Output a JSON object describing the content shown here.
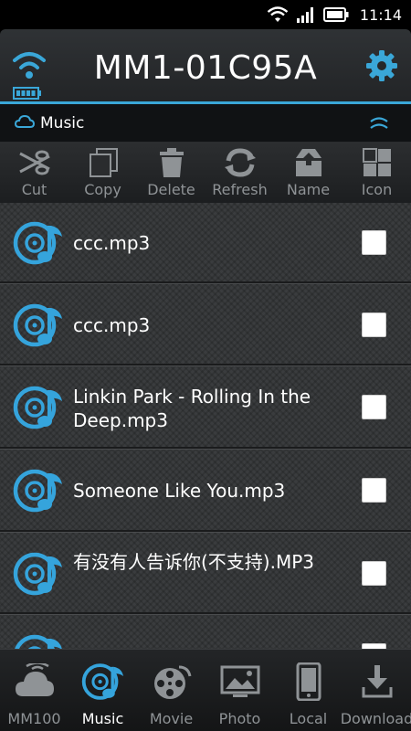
{
  "status_bar": {
    "time": "11:14"
  },
  "header": {
    "device_name": "MM1-01C95A"
  },
  "path": {
    "label": "Music"
  },
  "toolbar": {
    "items": [
      {
        "label": "Cut",
        "icon": "scissors-icon"
      },
      {
        "label": "Copy",
        "icon": "copy-icon"
      },
      {
        "label": "Delete",
        "icon": "trash-icon"
      },
      {
        "label": "Refresh",
        "icon": "refresh-icon"
      },
      {
        "label": "Name",
        "icon": "name-sort-icon"
      },
      {
        "label": "Icon",
        "icon": "grid-view-icon"
      }
    ]
  },
  "files": [
    {
      "name": "ccc.mp3",
      "checked": false
    },
    {
      "name": "ccc.mp3",
      "checked": false
    },
    {
      "name": "Linkin Park - Rolling In the Deep.mp3",
      "checked": false
    },
    {
      "name": "Someone Like You.mp3",
      "checked": false
    },
    {
      "name": "有没有人告诉你(不支持).MP3",
      "checked": false
    }
  ],
  "bottom_nav": {
    "items": [
      {
        "label": "MM100",
        "icon": "cloud-icon",
        "active": false
      },
      {
        "label": "Music",
        "icon": "music-disc-icon",
        "active": true
      },
      {
        "label": "Movie",
        "icon": "film-reel-icon",
        "active": false
      },
      {
        "label": "Photo",
        "icon": "photo-icon",
        "active": false
      },
      {
        "label": "Local",
        "icon": "phone-icon",
        "active": false
      },
      {
        "label": "Download",
        "icon": "download-icon",
        "active": false
      }
    ]
  },
  "colors": {
    "accent": "#3aa7d8",
    "icon_blue": "#35a4dc",
    "toolbar_gray": "#8f9396"
  }
}
